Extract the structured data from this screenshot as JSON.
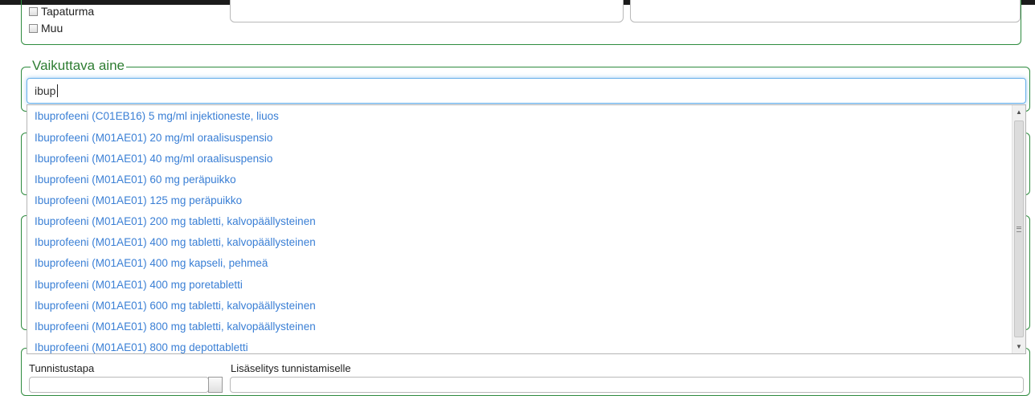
{
  "checkboxes": [
    {
      "label": "Tapaturma",
      "checked": false
    },
    {
      "label": "Muu",
      "checked": false
    }
  ],
  "active_substance": {
    "legend": "Vaikuttava aine",
    "input_value": "ibup"
  },
  "suggestions": [
    "Ibuprofeeni (C01EB16) 5 mg/ml injektioneste, liuos",
    "Ibuprofeeni (M01AE01) 20 mg/ml oraalisuspensio",
    "Ibuprofeeni (M01AE01) 40 mg/ml oraalisuspensio",
    "Ibuprofeeni (M01AE01) 60 mg peräpuikko",
    "Ibuprofeeni (M01AE01) 125 mg peräpuikko",
    "Ibuprofeeni (M01AE01) 200 mg tabletti, kalvopäällysteinen",
    "Ibuprofeeni (M01AE01) 400 mg tabletti, kalvopäällysteinen",
    "Ibuprofeeni (M01AE01) 400 mg kapseli, pehmeä",
    "Ibuprofeeni (M01AE01) 400 mg poretabletti",
    "Ibuprofeeni (M01AE01) 600 mg tabletti, kalvopäällysteinen",
    "Ibuprofeeni (M01AE01) 800 mg tabletti, kalvopäällysteinen",
    "Ibuprofeeni (M01AE01) 800 mg depottabletti"
  ],
  "identification": {
    "method_label": "Tunnistustapa",
    "details_label": "Lisäselitys tunnistamiselle"
  },
  "colors": {
    "fieldset_border": "#2e8b3e",
    "legend_text": "#2e7d32",
    "link_text": "#3a7fd5",
    "focus_glow": "#66afe9"
  },
  "icons": {
    "scroll_up": "scroll-up-arrow-icon",
    "scroll_down": "scroll-down-arrow-icon",
    "scroll_grip": "scroll-grip-icon"
  }
}
